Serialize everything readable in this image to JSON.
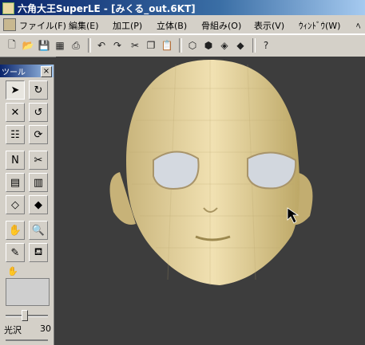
{
  "window": {
    "title": "六角大王SuperLE - [みくる_out.6KT]"
  },
  "menu": [
    "ファイル(F)",
    "編集(E)",
    "加工(P)",
    "立体(B)",
    "骨組み(O)",
    "表示(V)",
    "ｳｨﾝﾄﾞｳ(W)",
    "ﾍ"
  ],
  "palette": {
    "title": "ツール",
    "close": "×",
    "gloss_label": "光沢",
    "gloss_value": "30",
    "gloss_level_percent": 40
  },
  "colors": {
    "skin": "#e9d8a6",
    "skin_shadow": "#b8a36a",
    "eye_white": "#d6dbe2",
    "viewport_bg": "#3d3d3d"
  }
}
